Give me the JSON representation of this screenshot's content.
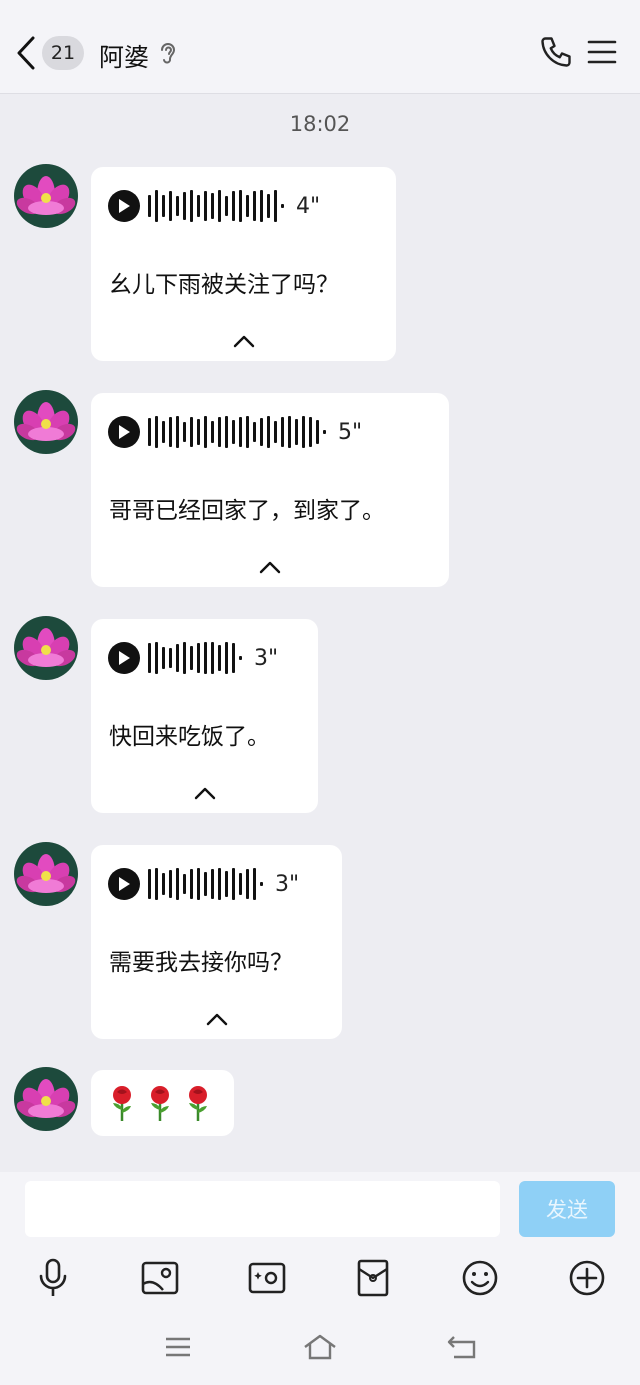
{
  "header": {
    "unread_count": "21",
    "title": "阿婆"
  },
  "timestamp": "18:02",
  "messages": [
    {
      "type": "voice",
      "duration": "4\"",
      "transcript": "幺儿下雨被关注了吗？"
    },
    {
      "type": "voice",
      "duration": "5\"",
      "transcript": "哥哥已经回家了，到家了。"
    },
    {
      "type": "voice",
      "duration": "3\"",
      "transcript": "快回来吃饭了。"
    },
    {
      "type": "voice",
      "duration": "3\"",
      "transcript": "需要我去接你吗？"
    },
    {
      "type": "emoji",
      "content": "🌹🌹🌹"
    }
  ],
  "input": {
    "placeholder": "",
    "send_label": "发送"
  },
  "toolbar": [
    "microphone-icon",
    "image-icon",
    "camera-icon",
    "red-packet-icon",
    "emoji-icon",
    "plus-icon"
  ],
  "colors": {
    "send_button": "#8fd0f6",
    "background": "#ededf2"
  }
}
